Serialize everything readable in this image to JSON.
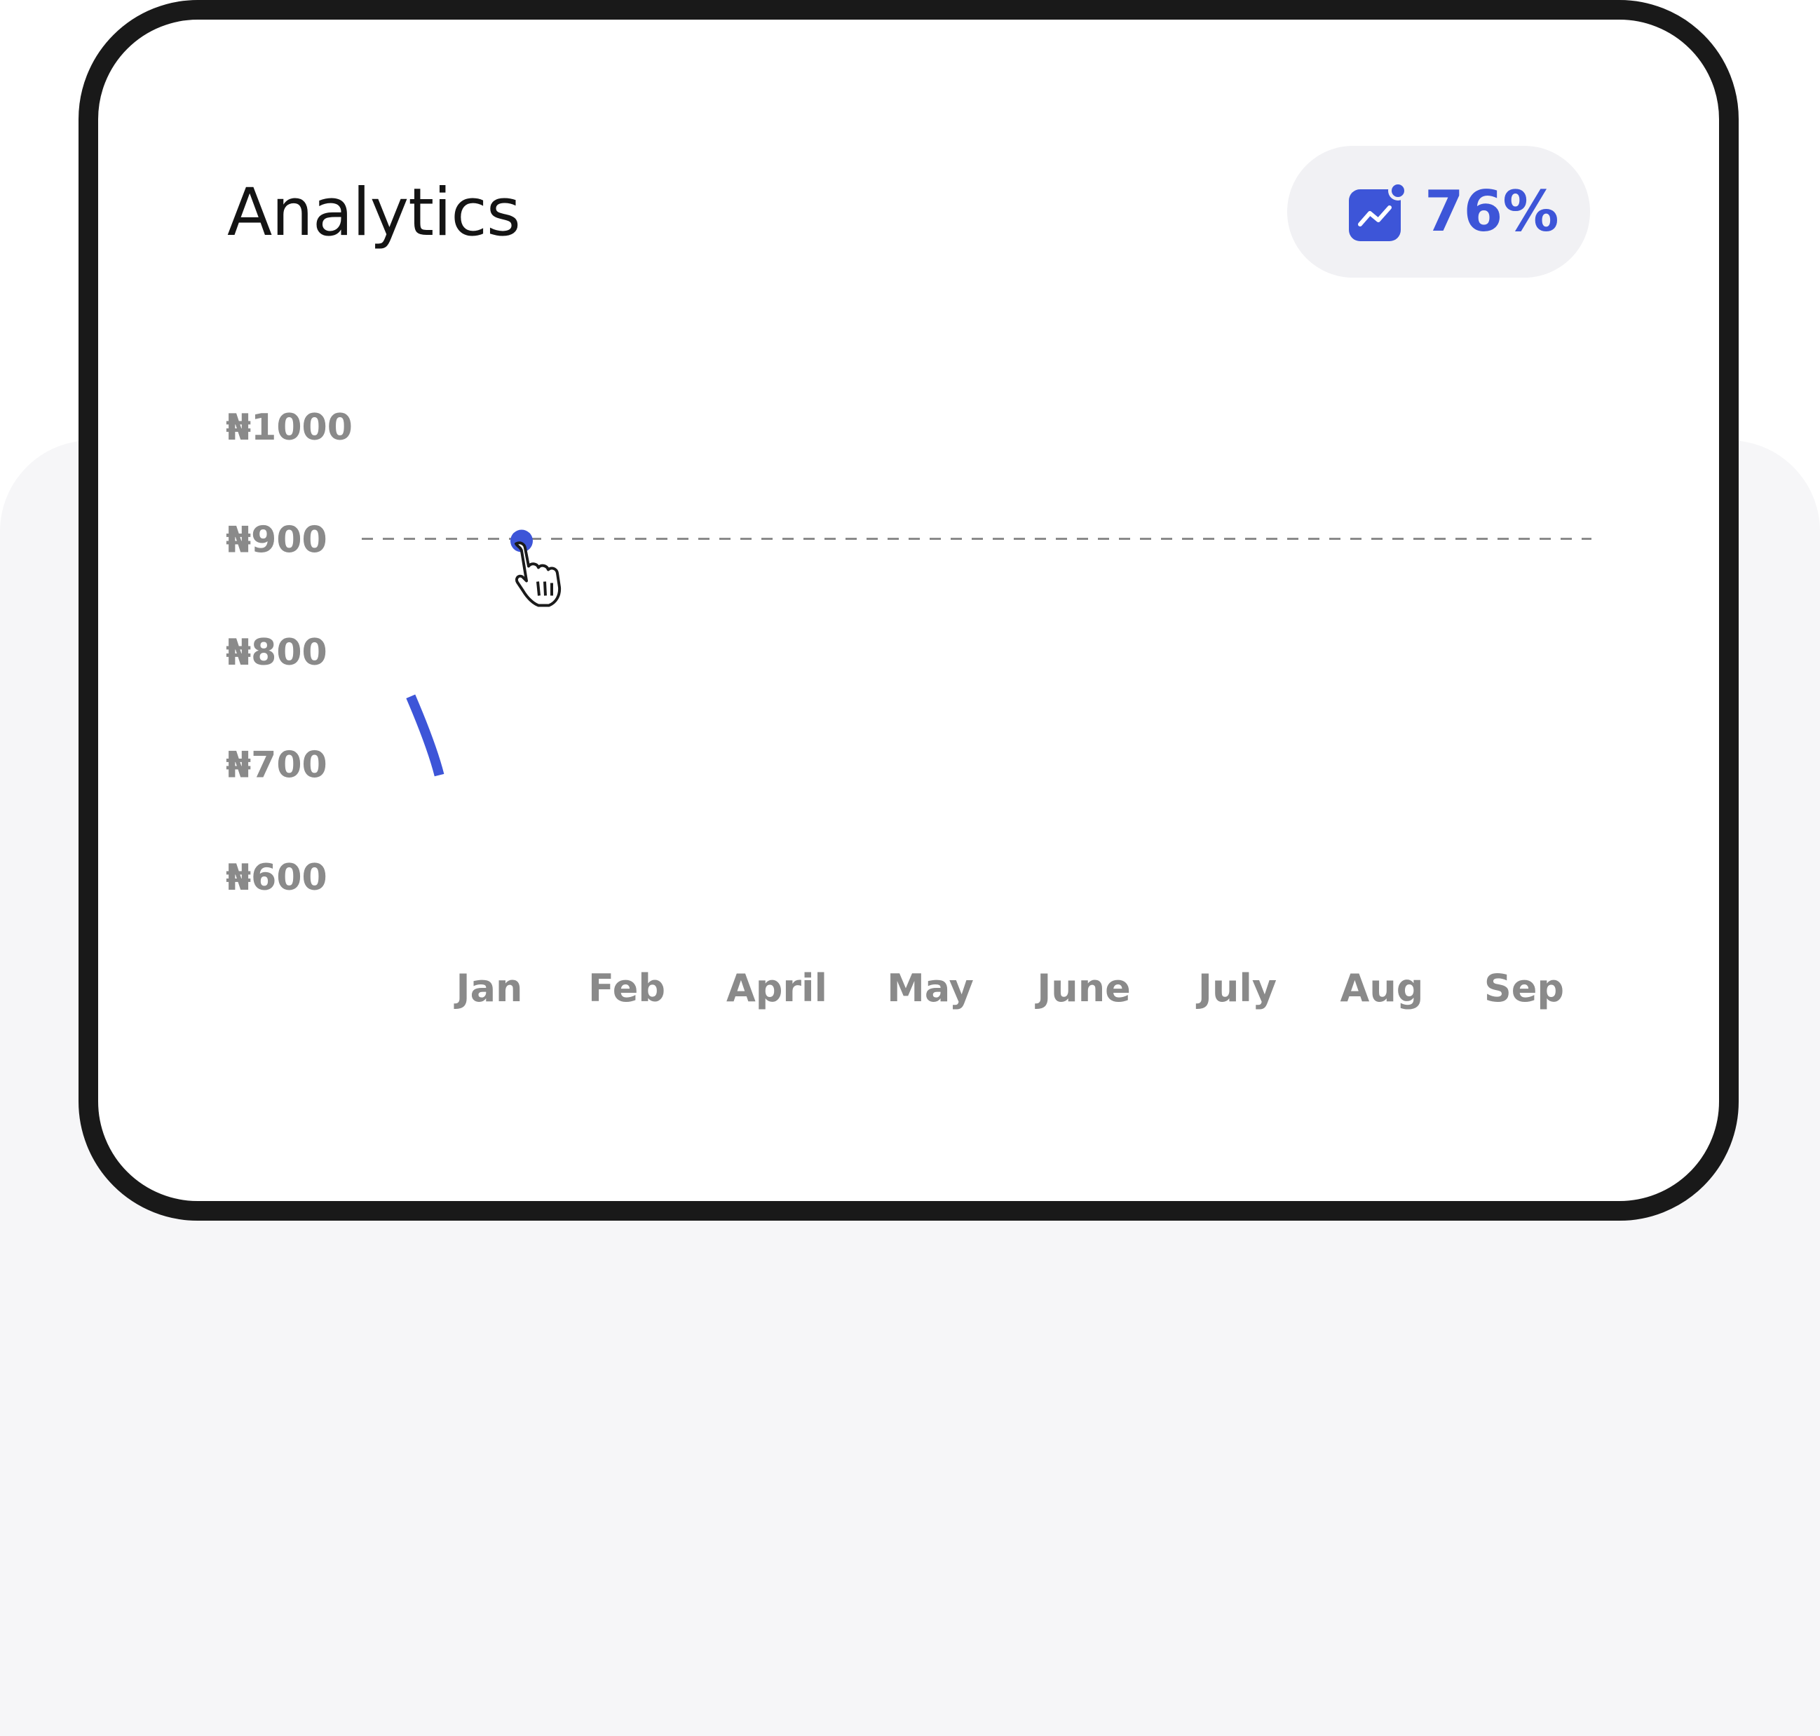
{
  "card": {
    "title": "Analytics",
    "badge": {
      "value": "76%",
      "icon": "trend-chart-icon",
      "color": "#3d55d8"
    }
  },
  "chart_data": {
    "type": "line",
    "categories": [
      "Jan",
      "Feb",
      "April",
      "May",
      "June",
      "July",
      "Aug",
      "Sep"
    ],
    "y_ticks": [
      "₦1000",
      "₦900",
      "₦800",
      "₦700",
      "₦600"
    ],
    "y_tick_values": [
      1000,
      900,
      800,
      700,
      600
    ],
    "ylim": [
      600,
      1000
    ],
    "reference_line": 900,
    "highlight_point": {
      "x": "Jan",
      "y": 900
    },
    "series_fragment": [
      {
        "x": -0.55,
        "y": 760
      },
      {
        "x": -0.35,
        "y": 690
      }
    ],
    "series_color": "#3d55d8",
    "grid": false
  }
}
